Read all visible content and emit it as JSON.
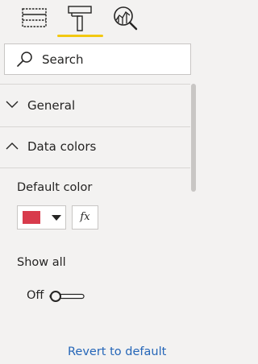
{
  "colors": {
    "accent": "#f2c811",
    "swatch": "#d83b4c",
    "link": "#2566b8"
  },
  "tabs": [
    {
      "icon": "fields-icon"
    },
    {
      "icon": "format-paint-roller-icon",
      "active": true
    },
    {
      "icon": "analytics-magnifier-icon"
    }
  ],
  "search": {
    "placeholder": "Search",
    "icon": "search-icon"
  },
  "sections": [
    {
      "label": "General",
      "expanded": false,
      "icon": "chevron-down-icon"
    },
    {
      "label": "Data colors",
      "expanded": true,
      "icon": "chevron-up-icon"
    }
  ],
  "data_colors": {
    "default_color_label": "Default color",
    "fx_label": "fx",
    "show_all_label": "Show all",
    "toggle_state": "Off"
  },
  "revert_label": "Revert to default"
}
